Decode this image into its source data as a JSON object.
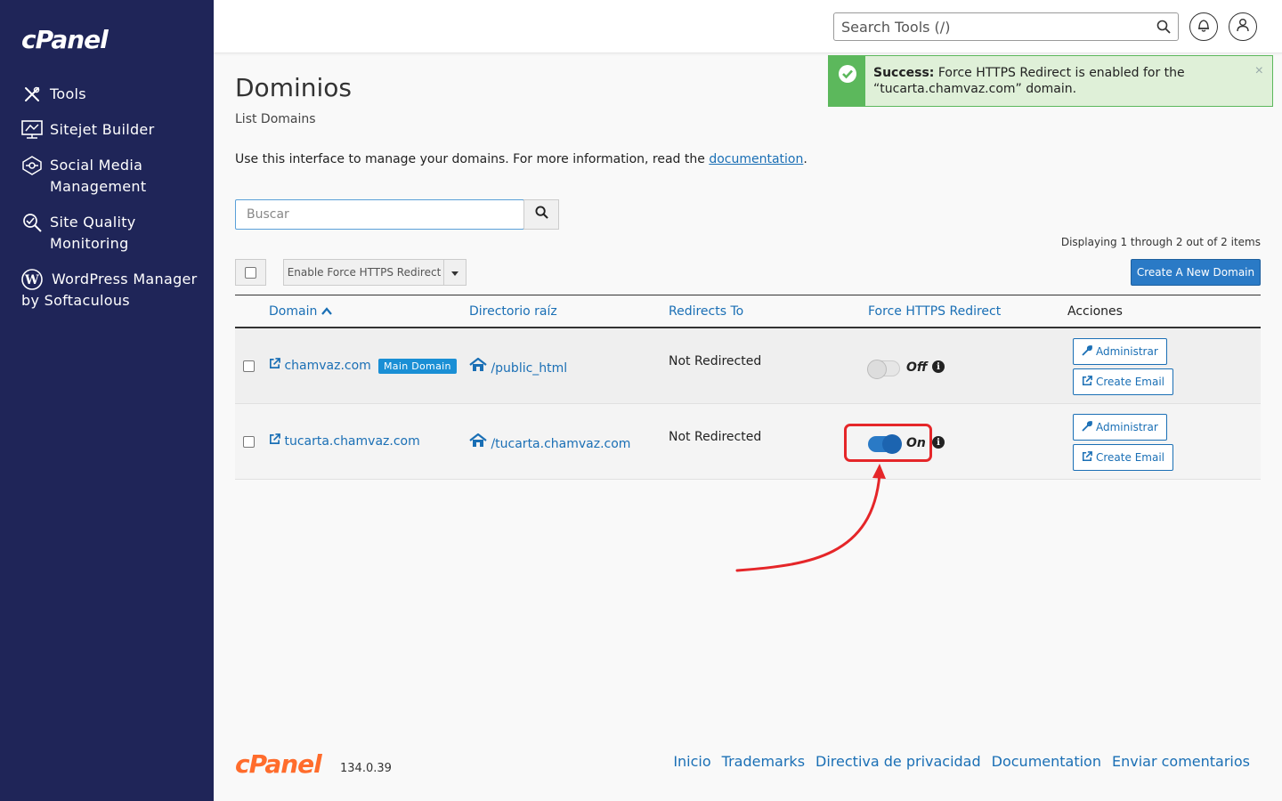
{
  "brand": {
    "logo_text": "cPanel",
    "version": "134.0.39"
  },
  "sidebar": {
    "items": [
      {
        "label": "Tools",
        "icon": "tools-icon"
      },
      {
        "label": "Sitejet Builder",
        "icon": "sitejet-icon"
      },
      {
        "label": "Social Media Management",
        "icon": "social-media-icon"
      },
      {
        "label": "Site Quality Monitoring",
        "icon": "site-quality-icon"
      },
      {
        "label": "WordPress Manager by Softaculous",
        "icon": "wordpress-icon"
      }
    ]
  },
  "topbar": {
    "search_placeholder": "Search Tools (/)"
  },
  "alert": {
    "title": "Success:",
    "message": "Force HTTPS Redirect is enabled for the “tucarta.chamvaz.com” domain.",
    "close": "×"
  },
  "page": {
    "title": "Dominios",
    "subtitle": "List Domains",
    "intro_text": "Use this interface to manage your domains. For more information, read the",
    "intro_link": "documentation",
    "intro_end": ".",
    "search_placeholder": "Buscar",
    "displaying": "Displaying 1 through 2 out of 2 items",
    "bulk_action": "Enable Force HTTPS Redirect",
    "create_button": "Create A New Domain"
  },
  "table": {
    "headers": {
      "domain": "Domain",
      "root": "Directorio raíz",
      "redirects": "Redirects To",
      "https": "Force HTTPS Redirect",
      "actions": "Acciones"
    },
    "rows": [
      {
        "domain": "chamvaz.com",
        "badge": "Main Domain",
        "root": "/public_html",
        "redirects": "Not Redirected",
        "https_state": "Off",
        "manage": "Administrar",
        "email": "Create Email"
      },
      {
        "domain": "tucarta.chamvaz.com",
        "badge": "",
        "root": "/tucarta.chamvaz.com",
        "redirects": "Not Redirected",
        "https_state": "On",
        "manage": "Administrar",
        "email": "Create Email"
      }
    ]
  },
  "footer": {
    "links": [
      "Inicio",
      "Trademarks",
      "Directiva de privacidad",
      "Documentation",
      "Enviar comentarios"
    ]
  },
  "colors": {
    "sidebar_bg": "#1f2558",
    "accent": "#1a6fb5",
    "success": "#5cb85c",
    "annotation": "#e52629",
    "footer_logo": "#ff6c2c"
  }
}
